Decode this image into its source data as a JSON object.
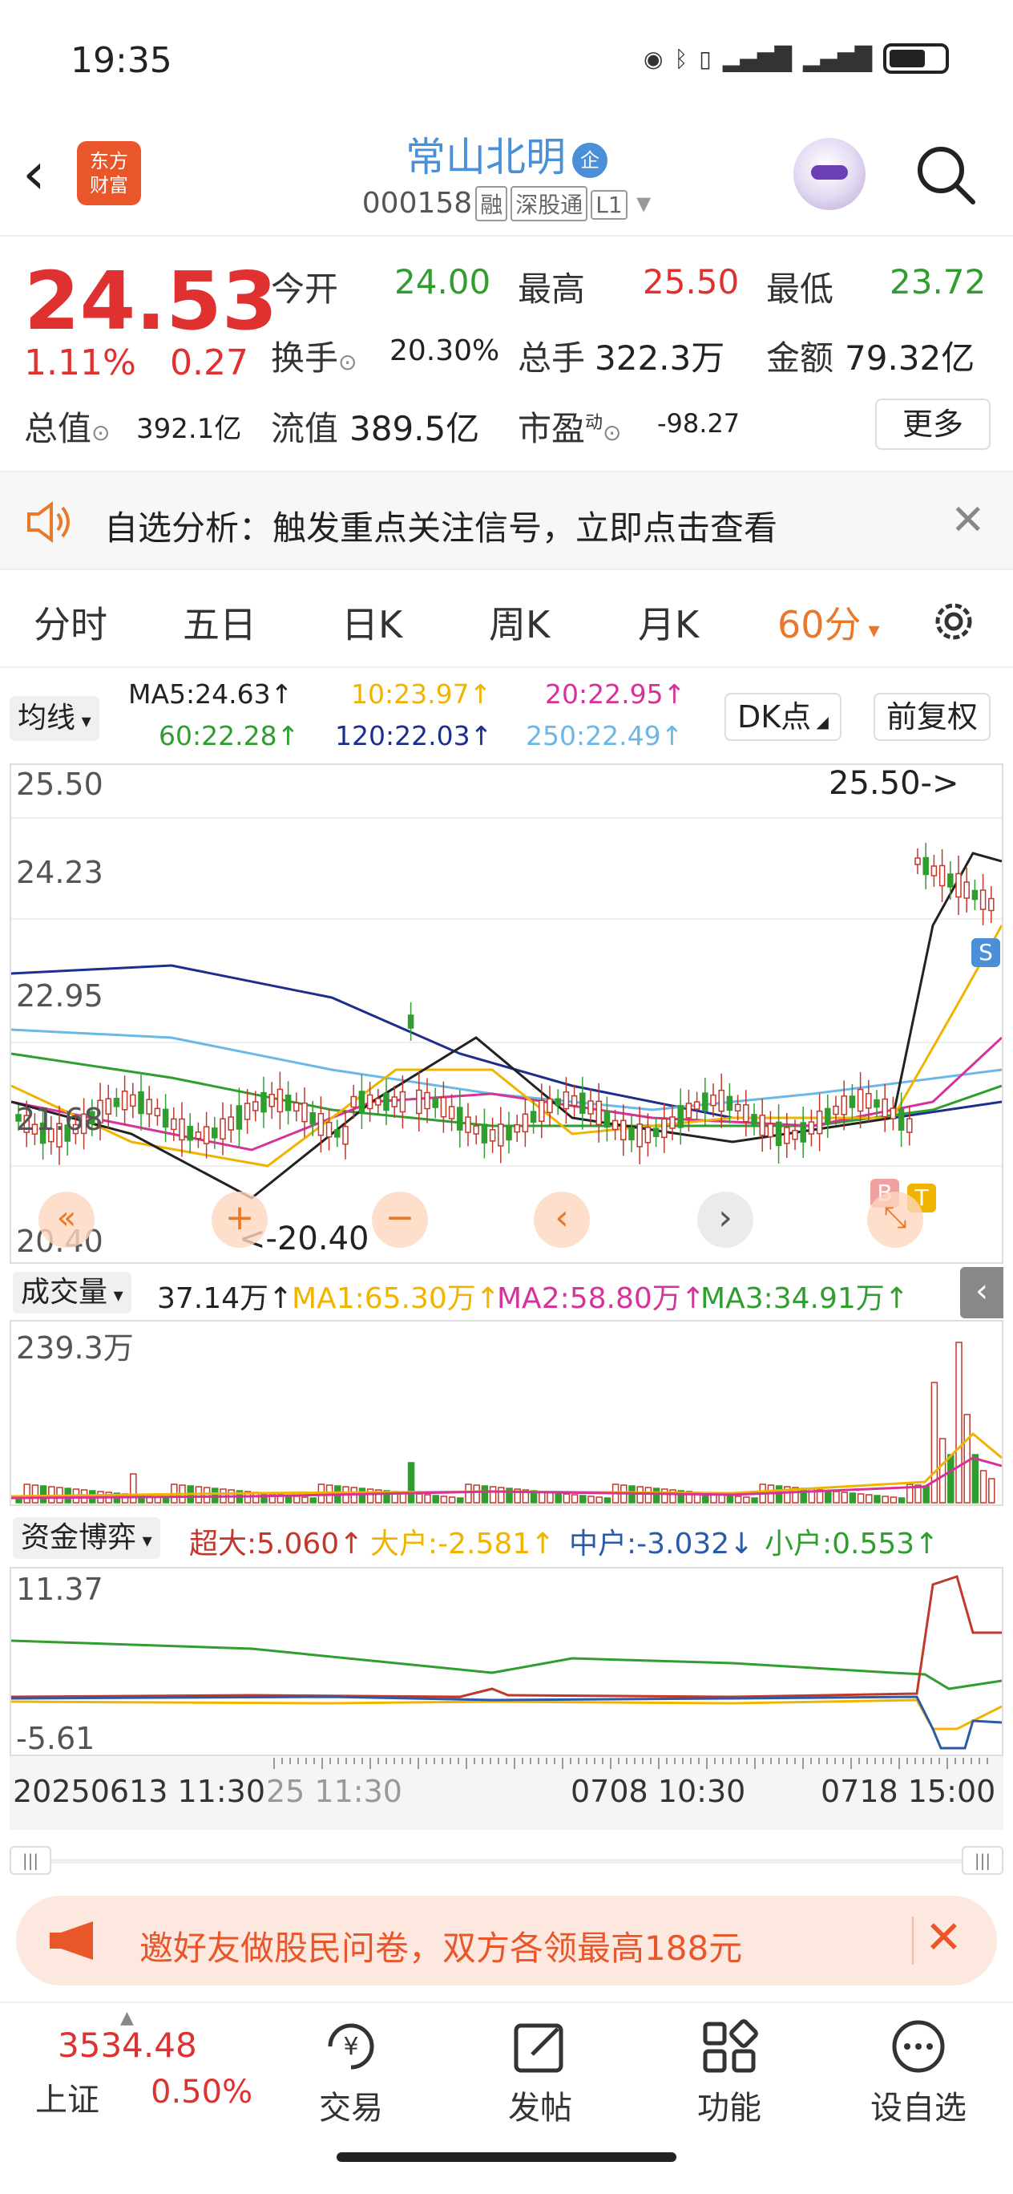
{
  "status": {
    "time": "19:35"
  },
  "header": {
    "logo_line1": "东方",
    "logo_line2": "财富",
    "stock_name": "常山北明",
    "badge": "企",
    "code": "000158",
    "tags": [
      "融",
      "深股通",
      "L1"
    ]
  },
  "quote": {
    "price": "24.53",
    "change_pct": "1.11%",
    "change_val": "0.27",
    "open_label": "今开",
    "open": "24.00",
    "high_label": "最高",
    "high": "25.50",
    "low_label": "最低",
    "low": "23.72",
    "turnover_label": "换手",
    "turnover": "20.30%",
    "volume_label": "总手",
    "volume": "322.3万",
    "amount_label": "金额",
    "amount": "79.32亿",
    "mcap_label": "总值",
    "mcap": "392.1亿",
    "float_label": "流值",
    "float": "389.5亿",
    "pe_label": "市盈",
    "pe_sup": "动",
    "pe": "-98.27",
    "more": "更多"
  },
  "analysis": {
    "text": "自选分析：触发重点关注信号，立即点击查看"
  },
  "tabs": [
    "分时",
    "五日",
    "日K",
    "周K",
    "月K",
    "60分"
  ],
  "active_tab": "60分",
  "ma": {
    "selector": "均线",
    "ma5": "MA5:24.63↑",
    "ma10": "10:23.97↑",
    "ma20": "20:22.95↑",
    "ma60": "60:22.28↑",
    "ma120": "120:22.03↑",
    "ma250": "250:22.49↑",
    "dk": "DK点",
    "adjust": "前复权",
    "colors": {
      "ma5": "#222222",
      "ma10": "#f0b400",
      "ma20": "#d6339a",
      "ma60": "#2f9e2f",
      "ma120": "#1c2e8f",
      "ma250": "#6ab8e8"
    }
  },
  "kchart": {
    "ticks": [
      "25.50",
      "24.23",
      "22.95",
      "21.68",
      "20.40"
    ],
    "max_note": "25.50->",
    "min_note": "<-20.40",
    "markers": [
      "S",
      "B",
      "T"
    ]
  },
  "volume": {
    "selector": "成交量",
    "value": "37.14万↑",
    "ma1": "MA1:65.30万↑",
    "ma2": "MA2:58.80万↑",
    "ma3": "MA3:34.91万↑",
    "max": "239.3万"
  },
  "fund": {
    "selector": "资金博弈",
    "super": "超大:5.060↑",
    "large": "大户:-2.581↑",
    "medium": "中户:-3.032↓",
    "small": "小户:0.553↑",
    "top": "11.37",
    "bottom": "-5.61"
  },
  "time_axis": {
    "left": "20250613 11:30",
    "left2": "25 11:30",
    "mid": "0708 10:30",
    "right": "0718 15:00"
  },
  "banner": {
    "text": "邀好友做股民问卷，双方各领最高188元"
  },
  "bottom_nav": {
    "index_value": "3534.48",
    "index_name": "上证",
    "index_pct": "0.50%",
    "items": [
      "交易",
      "发帖",
      "功能",
      "设自选"
    ]
  }
}
